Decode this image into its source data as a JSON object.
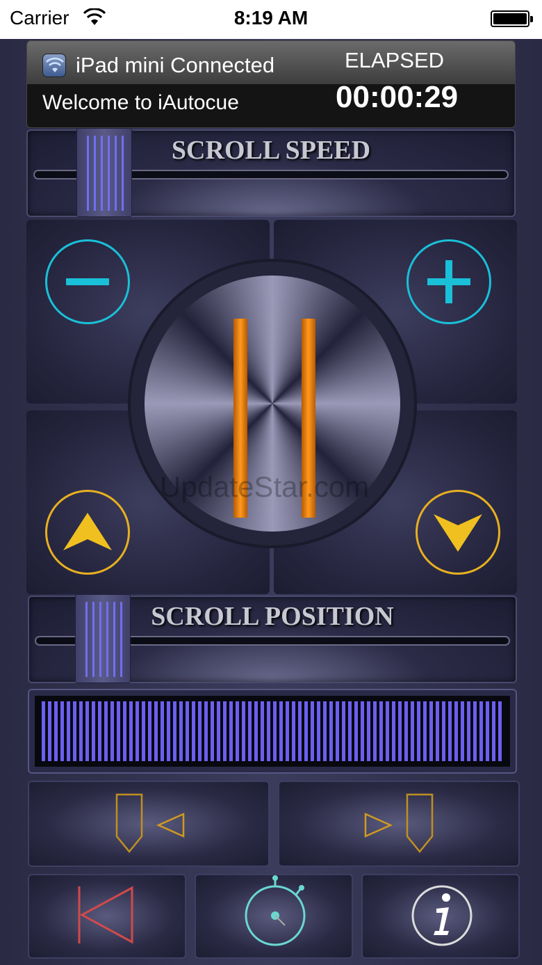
{
  "status_bar": {
    "carrier": "Carrier",
    "time": "8:19 AM",
    "icons": [
      "wifi-icon",
      "battery-icon"
    ]
  },
  "info": {
    "connection_text": "iPad mini Connected",
    "welcome_text": "Welcome to iAutocue",
    "elapsed_label": "ELAPSED",
    "elapsed_time": "00:00:29"
  },
  "scroll_speed": {
    "label": "SCROLL SPEED"
  },
  "controls": {
    "decrease": "minus-icon",
    "increase": "plus-icon",
    "play_pause": "pause-icon",
    "scroll_up": "up-arrow-icon",
    "scroll_down": "down-arrow-icon"
  },
  "scroll_position": {
    "label": "SCROLL POSITION"
  },
  "watermark": "UpdateStar.com",
  "colors": {
    "accent_cyan": "#1ac0d8",
    "accent_gold": "#e8b020",
    "pause_orange": "#ff9a20",
    "slider_ribs": "#7070ee",
    "reset_red": "#d04a4a"
  },
  "bottom_buttons": [
    "mark-left-icon",
    "mark-right-icon",
    "rewind-to-start-icon",
    "timer-icon",
    "info-icon"
  ]
}
